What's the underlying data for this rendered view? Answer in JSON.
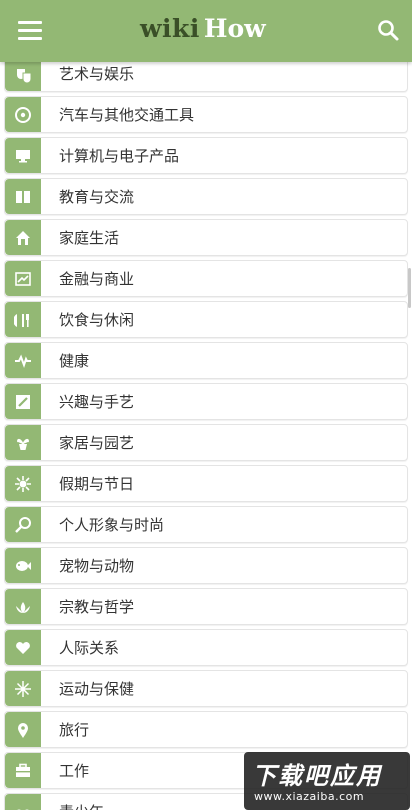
{
  "header": {
    "logo_wiki": "wiki",
    "logo_how": "How",
    "menu_icon": "hamburger-menu-icon",
    "search_icon": "search-icon",
    "bg_color": "#93b874"
  },
  "categories": [
    {
      "label": "艺术与娱乐",
      "icon": "theater-masks-icon"
    },
    {
      "label": "汽车与其他交通工具",
      "icon": "steering-wheel-icon"
    },
    {
      "label": "计算机与电子产品",
      "icon": "monitor-icon"
    },
    {
      "label": "教育与交流",
      "icon": "book-icon"
    },
    {
      "label": "家庭生活",
      "icon": "home-icon"
    },
    {
      "label": "金融与商业",
      "icon": "chart-icon"
    },
    {
      "label": "饮食与休闲",
      "icon": "fork-knife-icon"
    },
    {
      "label": "健康",
      "icon": "heartbeat-icon"
    },
    {
      "label": "兴趣与手艺",
      "icon": "pencil-icon"
    },
    {
      "label": "家居与园艺",
      "icon": "plant-pot-icon"
    },
    {
      "label": "假期与节日",
      "icon": "star-burst-icon"
    },
    {
      "label": "个人形象与时尚",
      "icon": "mirror-icon"
    },
    {
      "label": "宠物与动物",
      "icon": "fish-icon"
    },
    {
      "label": "宗教与哲学",
      "icon": "lotus-icon"
    },
    {
      "label": "人际关系",
      "icon": "heart-icon"
    },
    {
      "label": "运动与保健",
      "icon": "sport-icon"
    },
    {
      "label": "旅行",
      "icon": "map-pin-icon"
    },
    {
      "label": "工作",
      "icon": "briefcase-icon"
    },
    {
      "label": "青少年",
      "icon": "glasses-icon"
    }
  ],
  "watermark": {
    "title": "下载吧应用",
    "url": "www.xiazaiba.com"
  }
}
